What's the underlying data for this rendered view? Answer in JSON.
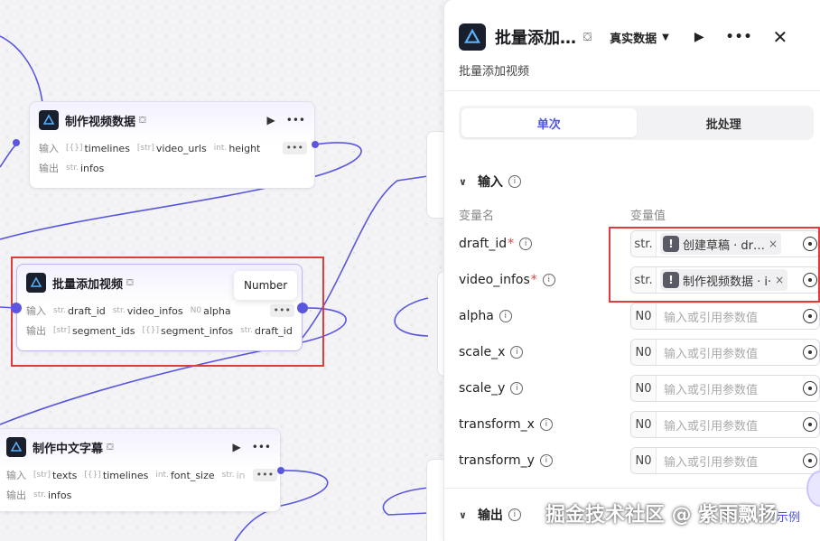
{
  "nodes": {
    "video_data": {
      "title": "制作视频数据",
      "store_icon": "store-icon",
      "input_label": "输入",
      "output_label": "输出",
      "inputs": [
        {
          "type": "[{}]",
          "name": "timelines"
        },
        {
          "type": "[str]",
          "name": "video_urls"
        },
        {
          "type": "int.",
          "name": "height"
        }
      ],
      "outputs": [
        {
          "type": "str.",
          "name": "infos"
        }
      ]
    },
    "batch_add": {
      "title": "批量添加视频",
      "store_icon": "store-icon",
      "input_label": "输入",
      "output_label": "输出",
      "inputs": [
        {
          "type": "str.",
          "name": "draft_id"
        },
        {
          "type": "str.",
          "name": "video_infos"
        },
        {
          "type": "N0",
          "name": "alpha"
        }
      ],
      "outputs": [
        {
          "type": "[str]",
          "name": "segment_ids"
        },
        {
          "type": "[{}]",
          "name": "segment_infos"
        },
        {
          "type": "str.",
          "name": "draft_id"
        }
      ],
      "tooltip": "Number"
    },
    "subtitle": {
      "title": "制作中文字幕",
      "store_icon": "store-icon",
      "input_label": "输入",
      "output_label": "输出",
      "inputs": [
        {
          "type": "[str]",
          "name": "texts"
        },
        {
          "type": "[{}]",
          "name": "timelines"
        },
        {
          "type": "int.",
          "name": "font_size"
        },
        {
          "type": "str.",
          "name": "in"
        }
      ],
      "outputs": [
        {
          "type": "str.",
          "name": "infos"
        }
      ]
    }
  },
  "panel": {
    "title": "批量添加…",
    "mode": "真实数据",
    "description": "批量添加视频",
    "tabs": [
      {
        "label": "单次",
        "active": true
      },
      {
        "label": "批处理",
        "active": false
      }
    ],
    "input_section": "输入",
    "col_name": "变量名",
    "col_value": "变量值",
    "params": [
      {
        "name": "draft_id",
        "required": true,
        "type": "str.",
        "ref": "创建草稿 · dr…"
      },
      {
        "name": "video_infos",
        "required": true,
        "type": "str.",
        "ref": "制作视频数据 · i·"
      },
      {
        "name": "alpha",
        "required": false,
        "type": "N0",
        "placeholder": "输入或引用参数值"
      },
      {
        "name": "scale_x",
        "required": false,
        "type": "N0",
        "placeholder": "输入或引用参数值"
      },
      {
        "name": "scale_y",
        "required": false,
        "type": "N0",
        "placeholder": "输入或引用参数值"
      },
      {
        "name": "transform_x",
        "required": false,
        "type": "N0",
        "placeholder": "输入或引用参数值"
      },
      {
        "name": "transform_y",
        "required": false,
        "type": "N0",
        "placeholder": "输入或引用参数值"
      }
    ],
    "output_section": "输出"
  },
  "watermark": "掘金技术社区 @ 紫雨飘扬",
  "watermark_partial": "示例",
  "colors": {
    "accent": "#4d53e8",
    "edge": "#5a56e0",
    "highlight": "#e23b3b"
  }
}
